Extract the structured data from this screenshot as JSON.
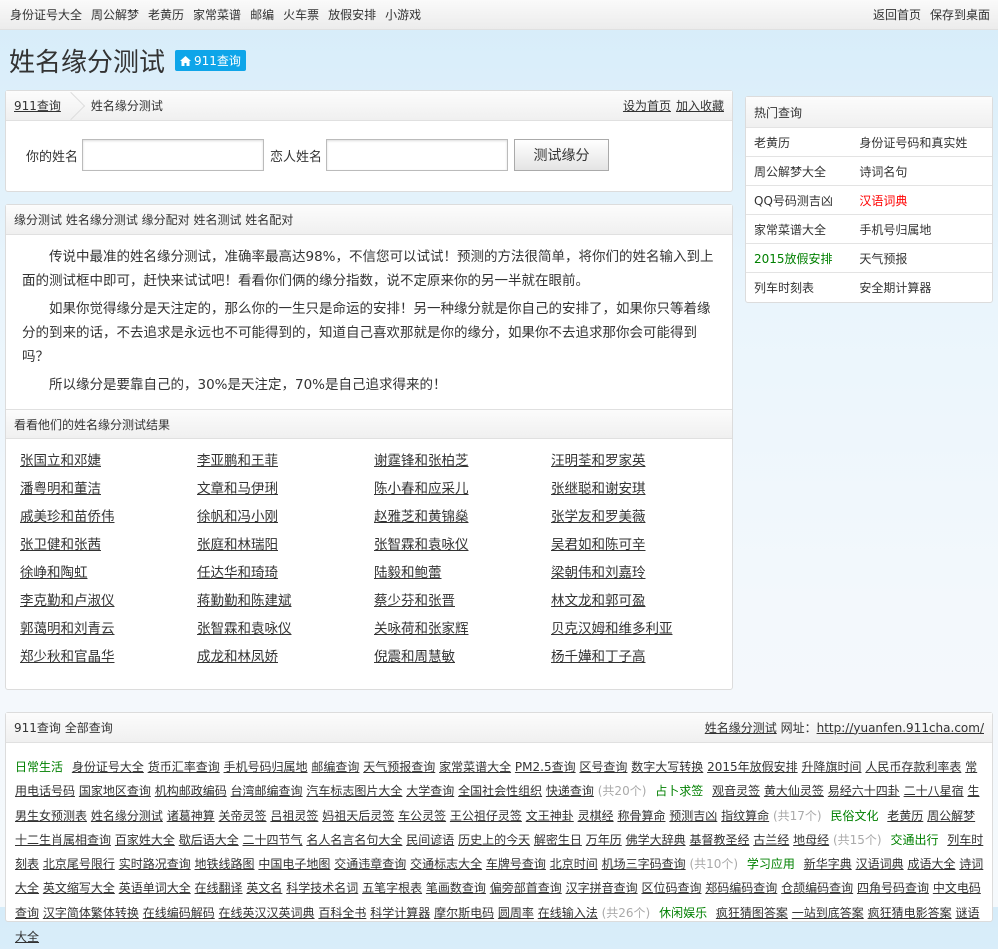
{
  "topnav": {
    "left": [
      "身份证号大全",
      "周公解梦",
      "老黄历",
      "家常菜谱",
      "邮编",
      "火车票",
      "放假安排",
      "小游戏"
    ],
    "right": [
      "返回首页",
      "保存到桌面"
    ]
  },
  "header": {
    "title": "姓名缘分测试",
    "badge": "911查询"
  },
  "breadcrumb": {
    "home": "911查询",
    "current": "姓名缘分测试",
    "set_home": "设为首页",
    "bookmark": "加入收藏"
  },
  "form": {
    "your_name_label": "你的姓名",
    "your_name_value": "",
    "lover_name_label": "恋人姓名",
    "lover_name_value": "",
    "submit": "测试缘分"
  },
  "intro": {
    "heading": "缘分测试 姓名缘分测试 缘分配对 姓名测试 姓名配对",
    "paragraphs": [
      "传说中最准的姓名缘分测试，准确率最高达98%，不信您可以试试！预测的方法很简单，将你们的姓名输入到上面的测试框中即可，赶快来试试吧！看看你们俩的缘分指数，说不定原来你的另一半就在眼前。",
      "如果你觉得缘分是天注定的，那么你的一生只是命运的安排！另一种缘分就是你自己的安排了，如果你只等着缘分的到来的话，不去追求是永远也不可能得到的，知道自己喜欢那就是你的缘分，如果你不去追求那你会可能得到吗？",
      "所以缘分是要靠自己的，30%是天注定，70%是自己追求得来的！"
    ]
  },
  "results": {
    "heading": "看看他们的姓名缘分测试结果",
    "names": [
      "张国立和邓婕",
      "李亚鹏和王菲",
      "谢霆锋和张柏芝",
      "汪明荃和罗家英",
      "潘粤明和董洁",
      "文章和马伊琍",
      "陈小春和应采儿",
      "张继聪和谢安琪",
      "戚美珍和苗侨伟",
      "徐帆和冯小刚",
      "赵雅芝和黄锦燊",
      "张学友和罗美薇",
      "张卫健和张茜",
      "张庭和林瑞阳",
      "张智霖和袁咏仪",
      "吴君如和陈可辛",
      "徐峥和陶虹",
      "任达华和琦琦",
      "陆毅和鲍蕾",
      "梁朝伟和刘嘉玲",
      "李克勤和卢淑仪",
      "蒋勤勤和陈建斌",
      "蔡少芬和张晋",
      "林文龙和郭可盈",
      "郭蔼明和刘青云",
      "张智霖和袁咏仪",
      "关咏荷和张家辉",
      "贝克汉姆和维多利亚",
      "郑少秋和官晶华",
      "成龙和林凤娇",
      "倪震和周慧敏",
      "杨千嬅和丁子高"
    ]
  },
  "sidebar": {
    "title": "热门查询",
    "items": [
      {
        "label": "老黄历"
      },
      {
        "label": "身份证号码和真实姓"
      },
      {
        "label": "周公解梦大全"
      },
      {
        "label": "诗词名句"
      },
      {
        "label": "QQ号码测吉凶"
      },
      {
        "label": "汉语词典",
        "color": "#ff0000"
      },
      {
        "label": "家常菜谱大全"
      },
      {
        "label": "手机号归属地"
      },
      {
        "label": "2015放假安排",
        "color": "#008000"
      },
      {
        "label": "天气预报"
      },
      {
        "label": "列车时刻表"
      },
      {
        "label": "安全期计算器"
      }
    ]
  },
  "allqueries": {
    "home": "911查询",
    "title": "全部查询",
    "site_link": "姓名缘分测试",
    "url_label": "网址：",
    "url": "http://yuanfen.911cha.com/",
    "items": [
      {
        "t": "cat",
        "v": "日常生活"
      },
      {
        "t": "a",
        "v": "身份证号大全"
      },
      {
        "t": "a",
        "v": "货币汇率查询"
      },
      {
        "t": "a",
        "v": "手机号码归属地"
      },
      {
        "t": "a",
        "v": "邮编查询"
      },
      {
        "t": "a",
        "v": "天气预报查询"
      },
      {
        "t": "a",
        "v": "家常菜谱大全"
      },
      {
        "t": "a",
        "v": "PM2.5查询"
      },
      {
        "t": "a",
        "v": "区号查询"
      },
      {
        "t": "a",
        "v": "数字大写转换"
      },
      {
        "t": "a",
        "v": "2015年放假安排"
      },
      {
        "t": "a",
        "v": "升降旗时间"
      },
      {
        "t": "a",
        "v": "人民币存款利率表"
      },
      {
        "t": "a",
        "v": "常用电话号码"
      },
      {
        "t": "a",
        "v": "国家地区查询"
      },
      {
        "t": "a",
        "v": "机构邮政编码"
      },
      {
        "t": "a",
        "v": "台湾邮编查询"
      },
      {
        "t": "a",
        "v": "汽车标志图片大全"
      },
      {
        "t": "a",
        "v": "大学查询"
      },
      {
        "t": "a",
        "v": "全国社会性组织"
      },
      {
        "t": "a",
        "v": "快递查询"
      },
      {
        "t": "cnt",
        "v": "(共20个)"
      },
      {
        "t": "cat",
        "v": "占卜求签"
      },
      {
        "t": "a",
        "v": "观音灵签"
      },
      {
        "t": "a",
        "v": "黄大仙灵签"
      },
      {
        "t": "a",
        "v": "易经六十四卦"
      },
      {
        "t": "a",
        "v": "二十八星宿"
      },
      {
        "t": "a",
        "v": "生男生女预测表"
      },
      {
        "t": "a",
        "v": "姓名缘分测试"
      },
      {
        "t": "a",
        "v": "诸葛神算"
      },
      {
        "t": "a",
        "v": "关帝灵签"
      },
      {
        "t": "a",
        "v": "吕祖灵签"
      },
      {
        "t": "a",
        "v": "妈祖天后灵签"
      },
      {
        "t": "a",
        "v": "车公灵签"
      },
      {
        "t": "a",
        "v": "王公祖仔灵签"
      },
      {
        "t": "a",
        "v": "文王神卦"
      },
      {
        "t": "a",
        "v": "灵棋经"
      },
      {
        "t": "a",
        "v": "称骨算命"
      },
      {
        "t": "a",
        "v": "预测吉凶"
      },
      {
        "t": "a",
        "v": "指纹算命"
      },
      {
        "t": "cnt",
        "v": "(共17个)"
      },
      {
        "t": "cat",
        "v": "民俗文化"
      },
      {
        "t": "a",
        "v": "老黄历"
      },
      {
        "t": "a",
        "v": "周公解梦"
      },
      {
        "t": "a",
        "v": "十二生肖属相查询"
      },
      {
        "t": "a",
        "v": "百家姓大全"
      },
      {
        "t": "a",
        "v": "歇后语大全"
      },
      {
        "t": "a",
        "v": "二十四节气"
      },
      {
        "t": "a",
        "v": "名人名言名句大全"
      },
      {
        "t": "a",
        "v": "民间谚语"
      },
      {
        "t": "a",
        "v": "历史上的今天"
      },
      {
        "t": "a",
        "v": "解密生日"
      },
      {
        "t": "a",
        "v": "万年历"
      },
      {
        "t": "a",
        "v": "佛学大辞典"
      },
      {
        "t": "a",
        "v": "基督教圣经"
      },
      {
        "t": "a",
        "v": "古兰经"
      },
      {
        "t": "a",
        "v": "地母经"
      },
      {
        "t": "cnt",
        "v": "(共15个)"
      },
      {
        "t": "cat",
        "v": "交通出行"
      },
      {
        "t": "a",
        "v": "列车时刻表"
      },
      {
        "t": "a",
        "v": "北京尾号限行"
      },
      {
        "t": "a",
        "v": "实时路况查询"
      },
      {
        "t": "a",
        "v": "地铁线路图"
      },
      {
        "t": "a",
        "v": "中国电子地图"
      },
      {
        "t": "a",
        "v": "交通违章查询"
      },
      {
        "t": "a",
        "v": "交通标志大全"
      },
      {
        "t": "a",
        "v": "车牌号查询"
      },
      {
        "t": "a",
        "v": "北京时间"
      },
      {
        "t": "a",
        "v": "机场三字码查询"
      },
      {
        "t": "cnt",
        "v": "(共10个)"
      },
      {
        "t": "cat",
        "v": "学习应用"
      },
      {
        "t": "a",
        "v": "新华字典"
      },
      {
        "t": "a",
        "v": "汉语词典"
      },
      {
        "t": "a",
        "v": "成语大全"
      },
      {
        "t": "a",
        "v": "诗词大全"
      },
      {
        "t": "a",
        "v": "英文缩写大全"
      },
      {
        "t": "a",
        "v": "英语单词大全"
      },
      {
        "t": "a",
        "v": "在线翻译"
      },
      {
        "t": "a",
        "v": "英文名"
      },
      {
        "t": "a",
        "v": "科学技术名词"
      },
      {
        "t": "a",
        "v": "五笔字根表"
      },
      {
        "t": "a",
        "v": "笔画数查询"
      },
      {
        "t": "a",
        "v": "偏旁部首查询"
      },
      {
        "t": "a",
        "v": "汉字拼音查询"
      },
      {
        "t": "a",
        "v": "区位码查询"
      },
      {
        "t": "a",
        "v": "郑码编码查询"
      },
      {
        "t": "a",
        "v": "仓颉编码查询"
      },
      {
        "t": "a",
        "v": "四角号码查询"
      },
      {
        "t": "a",
        "v": "中文电码查询"
      },
      {
        "t": "a",
        "v": "汉字简体繁体转换"
      },
      {
        "t": "a",
        "v": "在线编码解码"
      },
      {
        "t": "a",
        "v": "在线英汉汉英词典"
      },
      {
        "t": "a",
        "v": "百科全书"
      },
      {
        "t": "a",
        "v": "科学计算器"
      },
      {
        "t": "a",
        "v": "摩尔斯电码"
      },
      {
        "t": "a",
        "v": "圆周率"
      },
      {
        "t": "a",
        "v": "在线输入法"
      },
      {
        "t": "cnt",
        "v": "(共26个)"
      },
      {
        "t": "cat",
        "v": "休闲娱乐"
      },
      {
        "t": "a",
        "v": "疯狂猜图答案"
      },
      {
        "t": "a",
        "v": "一站到底答案"
      },
      {
        "t": "a",
        "v": "疯狂猜电影答案"
      },
      {
        "t": "a",
        "v": "谜语大全"
      }
    ]
  }
}
